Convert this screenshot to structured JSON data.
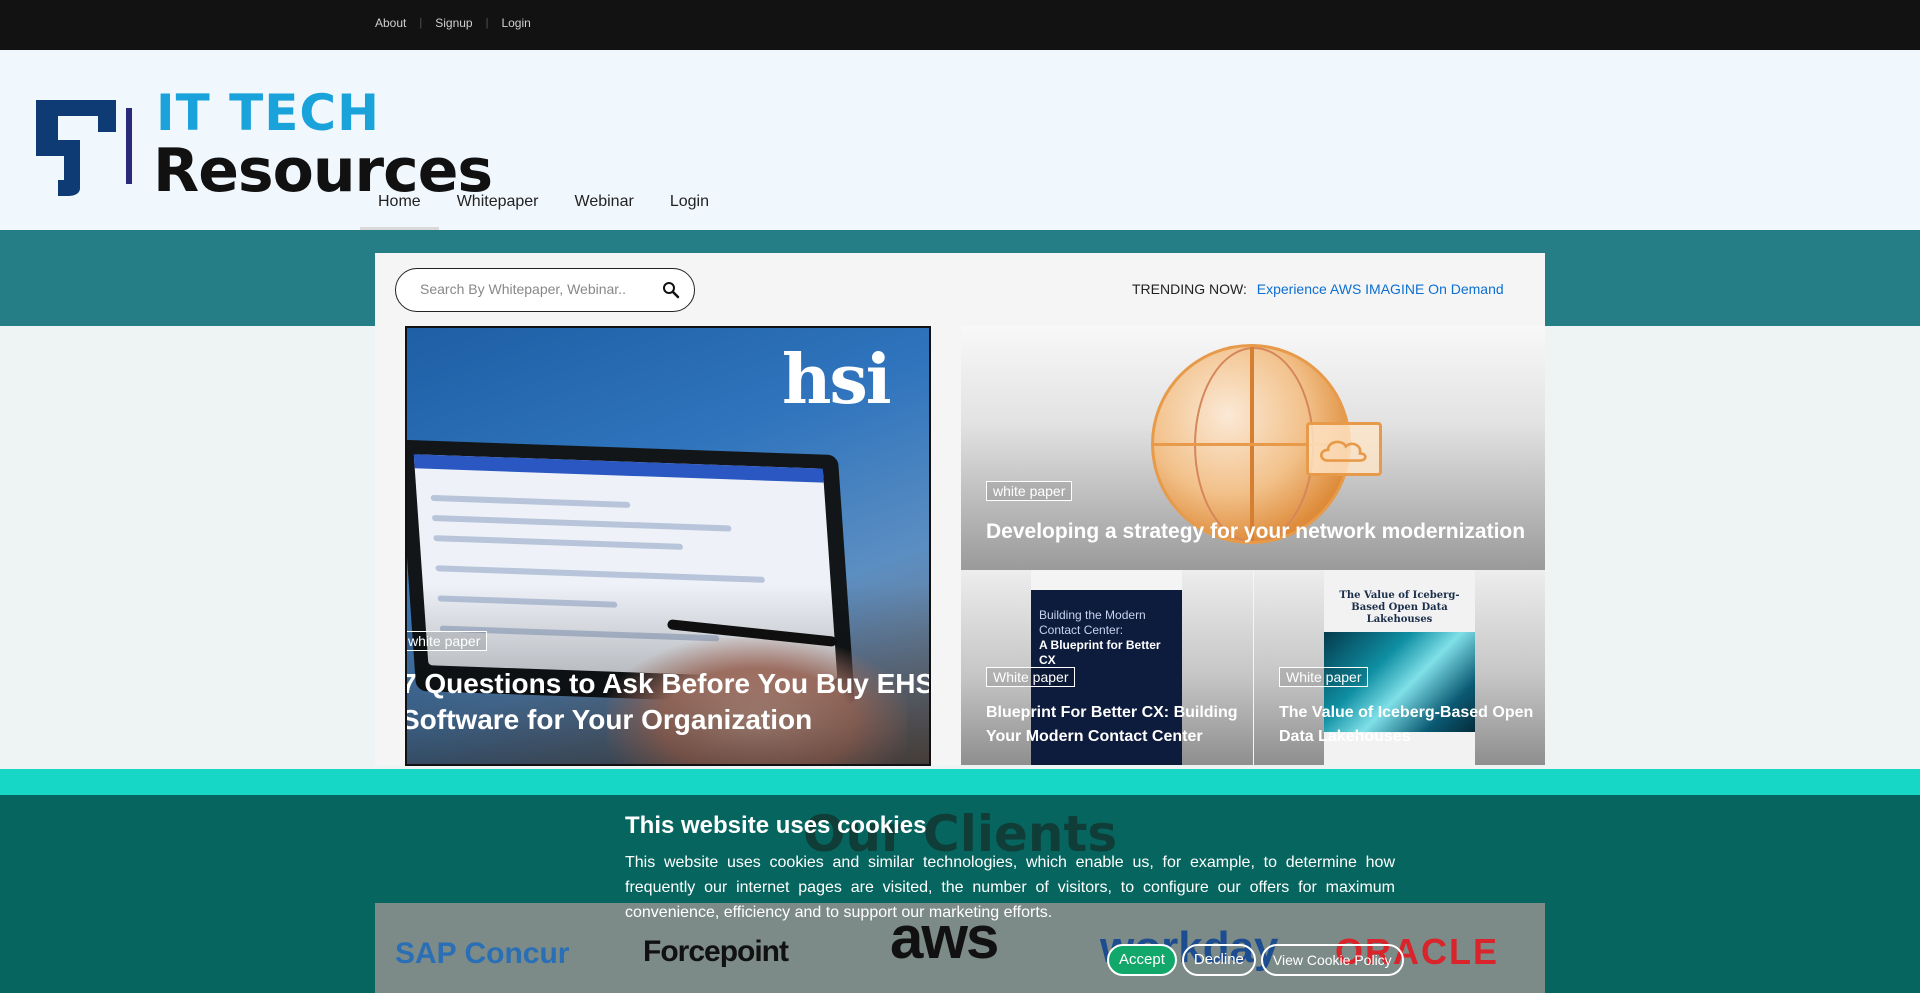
{
  "topbar": {
    "links": [
      "About",
      "Signup",
      "Login"
    ]
  },
  "logo": {
    "line1": "IT TECH",
    "line2": "Resources"
  },
  "nav": {
    "items": [
      "Home",
      "Whitepaper",
      "Webinar",
      "Login"
    ]
  },
  "search": {
    "placeholder": "Search By Whitepaper, Webinar.."
  },
  "trending": {
    "label": "TRENDING NOW:",
    "value": "Experience AWS IMAGINE On Demand"
  },
  "cards": {
    "big": {
      "tag": "white paper",
      "title": "7 Questions to Ask Before You Buy EHS Software for Your Organization",
      "brand": "hsi"
    },
    "top": {
      "tag": "white paper",
      "title": "Developing a strategy for your network modernization"
    },
    "sm1": {
      "tag": "White paper",
      "title": "Blueprint For Better CX: Building Your Modern Contact Center",
      "cover_text": "Building the Modern Contact Center:",
      "cover_bold": "A Blueprint for Better CX"
    },
    "sm2": {
      "tag": "White paper",
      "title": "The Value of Iceberg-Based Open Data Lakehouses",
      "cover_text": "The Value of Iceberg-Based Open Data Lakehouses"
    }
  },
  "clients": {
    "heading": "Our Clients",
    "logos": [
      "SAP Concur",
      "Forcepoint",
      "aws",
      "workday",
      "ORACLE"
    ]
  },
  "cookie": {
    "title": "This website uses cookies",
    "body": "This website uses cookies and similar technologies, which enable us, for example, to determine how frequently our internet pages are visited, the number of visitors, to configure our offers for maximum convenience, efficiency and to support our marketing efforts.",
    "accept": "Accept",
    "decline": "Decline",
    "policy": "View Cookie Policy"
  },
  "colors": {
    "accent_teal": "#257e86",
    "cyan": "#16d6c5",
    "link_blue": "#0d6fd0",
    "accept_green": "#12a86b"
  }
}
